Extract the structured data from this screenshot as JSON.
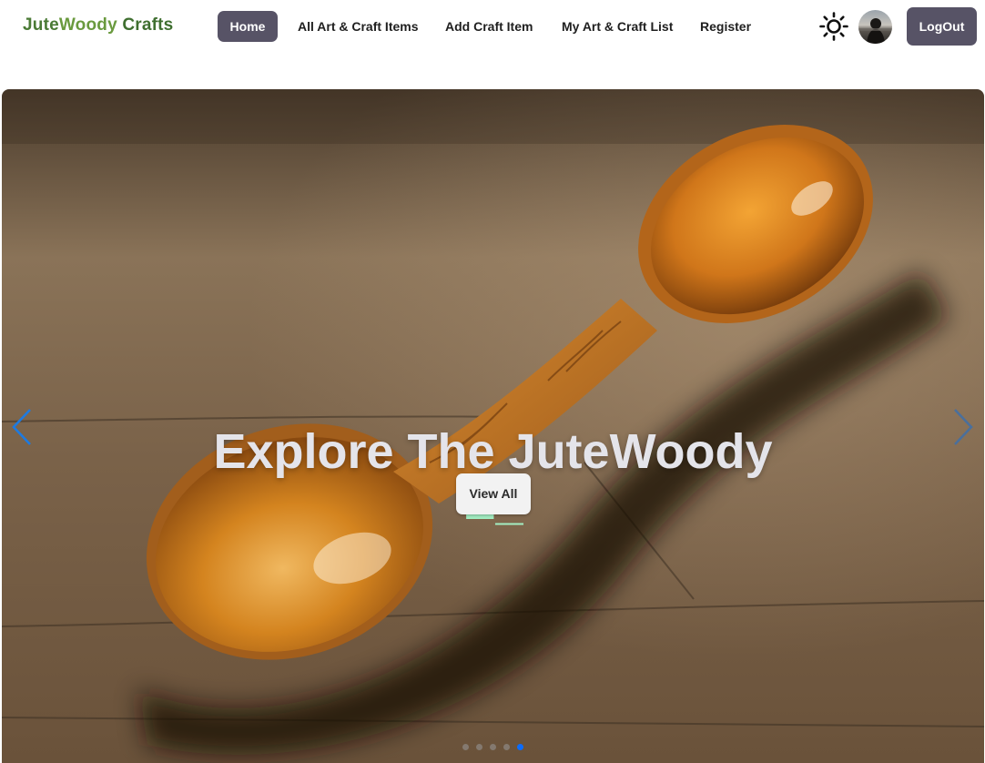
{
  "navbar": {
    "brand": {
      "part1": "Jute",
      "part2": "Woody",
      "part3": " Crafts"
    },
    "links": [
      {
        "label": "Home",
        "active": true
      },
      {
        "label": "All Art & Craft Items",
        "active": false
      },
      {
        "label": "Add Craft Item",
        "active": false
      },
      {
        "label": "My Art & Craft List",
        "active": false
      },
      {
        "label": "Register",
        "active": false
      }
    ],
    "theme_toggle_icon": "sun-icon",
    "avatar_icon": "user-avatar",
    "logout_label": "LogOut"
  },
  "hero": {
    "title": "Explore The JuteWoody",
    "typed_text": "E_",
    "button_label": "View All",
    "prev_icon": "chevron-left-icon",
    "next_icon": "chevron-right-icon",
    "slide_count": 5,
    "active_slide": 5
  },
  "colors": {
    "accent_button": "#575366",
    "brand_green": "#4a7a35",
    "typed_text": "#a3eec2",
    "active_dot": "#0a6cff"
  }
}
